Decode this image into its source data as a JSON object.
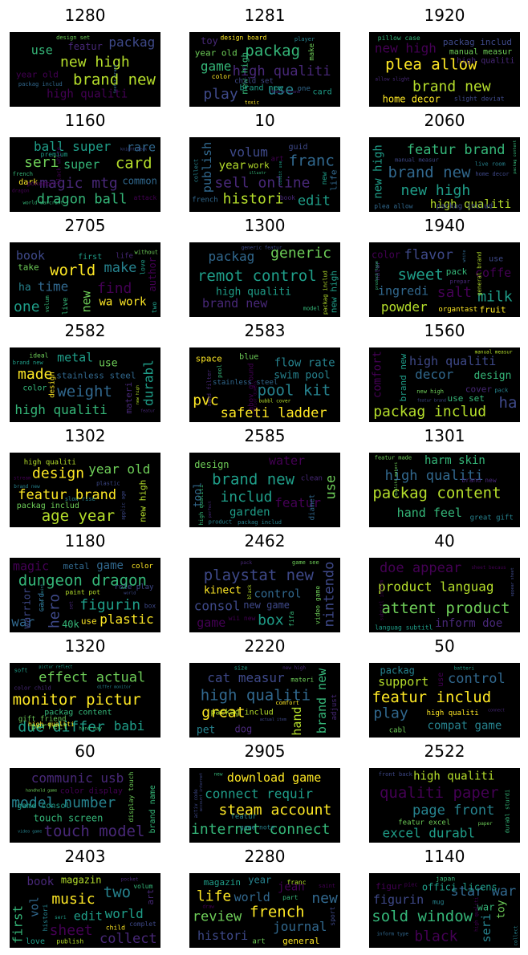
{
  "chart_data": [
    {
      "type": "wordcloud",
      "title": "1280",
      "words": [
        "brand new",
        "new high",
        "packag",
        "use",
        "high qualiti",
        "featur",
        "year old",
        "design set",
        "packag includ",
        "featur brand"
      ]
    },
    {
      "type": "wordcloud",
      "title": "1281",
      "words": [
        "packag",
        "play",
        "use",
        "high qualiti",
        "game",
        "year old",
        "new high",
        "brand new",
        "make",
        "child set",
        "toy",
        "card",
        "color",
        "one",
        "player",
        "design board",
        "featur brand",
        "toxic"
      ]
    },
    {
      "type": "wordcloud",
      "title": "1920",
      "words": [
        "plea allow",
        "brand new",
        "new high",
        "packag includ",
        "high qualiti",
        "home decor",
        "manual measur",
        "pillow case",
        "slight deviat",
        "allow slight"
      ]
    },
    {
      "type": "wordcloud",
      "title": "1160",
      "words": [
        "card",
        "magic mtg",
        "seri",
        "dragon ball",
        "ball super",
        "super",
        "rare",
        "common",
        "dark",
        "pokemon",
        "premium",
        "black white",
        "world warcraft",
        "knight deck",
        "attack",
        "french",
        "dragon"
      ]
    },
    {
      "type": "wordcloud",
      "title": "10",
      "words": [
        "franc",
        "sell online",
        "histori",
        "edit",
        "volum",
        "year",
        "publish",
        "life",
        "guid",
        "work",
        "book",
        "french",
        "art",
        "new",
        "collect",
        "condit use",
        "illustr"
      ]
    },
    {
      "type": "wordcloud",
      "title": "2060",
      "words": [
        "brand new",
        "new high",
        "featur brand",
        "high qualiti",
        "new high",
        "packag includ",
        "plea allow",
        "home decor",
        "manual measur",
        "packag content",
        "live room"
      ]
    },
    {
      "type": "wordcloud",
      "title": "2705",
      "words": [
        "world",
        "one",
        "find",
        "make",
        "time",
        "new",
        "book",
        "wa work",
        "ha",
        "take",
        "author",
        "live",
        "first",
        "life",
        "love",
        "volum",
        "two",
        "without"
      ]
    },
    {
      "type": "wordcloud",
      "title": "1300",
      "words": [
        "remot control",
        "generic",
        "packag",
        "brand new",
        "high qualiti",
        "new high",
        "generic featur",
        "packag includ",
        "model"
      ]
    },
    {
      "type": "wordcloud",
      "title": "1940",
      "words": [
        "sweet",
        "salt",
        "milk",
        "flavor",
        "powder",
        "ingredi",
        "coffe",
        "general brand",
        "fruit",
        "pack",
        "color",
        "organtast",
        "use",
        "natur",
        "white",
        "product type",
        "prepar"
      ]
    },
    {
      "type": "wordcloud",
      "title": "2582",
      "words": [
        "weight",
        "made",
        "durabl",
        "high qualiti",
        "metal",
        "stainless steel",
        "design",
        "use",
        "color",
        "materi",
        "brand new",
        "featur",
        "ideal",
        "new high"
      ]
    },
    {
      "type": "wordcloud",
      "title": "2583",
      "words": [
        "pool kit",
        "pvc",
        "safeti ladder",
        "abov ground",
        "flow rate",
        "swim pool",
        "stainless steel",
        "space",
        "sand filter",
        "blue",
        "bubbl cover",
        "interior dimens",
        "pool"
      ]
    },
    {
      "type": "wordcloud",
      "title": "1560",
      "words": [
        "ha",
        "packag includ",
        "brand new",
        "decor",
        "high qualiti",
        "comfort",
        "design",
        "use set",
        "cover",
        "new high",
        "manual measur",
        "pack",
        "featur brand"
      ]
    },
    {
      "type": "wordcloud",
      "title": "1302",
      "words": [
        "age year",
        "design",
        "featur brand",
        "year old",
        "new high",
        "packag includ",
        "high qualiti",
        "slow rise",
        "brand new",
        "plastic",
        "applic age",
        "stream"
      ]
    },
    {
      "type": "wordcloud",
      "title": "2585",
      "words": [
        "brand new",
        "includ",
        "use",
        "featur",
        "water",
        "garden",
        "tool",
        "diamet",
        "design",
        "high qualiti",
        "product",
        "clean",
        "packag includ",
        "perfect"
      ]
    },
    {
      "type": "wordcloud",
      "title": "1301",
      "words": [
        "packag content",
        "high qualiti",
        "hand feel",
        "harm skin",
        "brand new",
        "great gift",
        "qualiti materi",
        "featur made"
      ]
    },
    {
      "type": "wordcloud",
      "title": "1180",
      "words": [
        "dungeon dragon",
        "figurin",
        "hero",
        "war",
        "warrior",
        "plastic",
        "magic",
        "game",
        "metal",
        "role play",
        "color",
        "40k",
        "use",
        "card",
        "paint pot",
        "world",
        "box",
        "set",
        "acryl paint"
      ]
    },
    {
      "type": "wordcloud",
      "title": "2462",
      "words": [
        "playstat new",
        "box",
        "nintendo",
        "consol",
        "game",
        "control",
        "new game",
        "kinect",
        "wii new",
        "game see",
        "video game",
        "black",
        "fifa",
        "pack"
      ]
    },
    {
      "type": "wordcloud",
      "title": "40",
      "words": [
        "attent product",
        "doe appear",
        "product languag",
        "inform doe",
        "subtitl inform",
        "languag subtitl",
        "appear sheet",
        "sheet becaus"
      ]
    },
    {
      "type": "wordcloud",
      "title": "1320",
      "words": [
        "monitor pictur",
        "due differ",
        "effect actual",
        "babi",
        "perfect",
        "packag content",
        "gift friend",
        "high qualiti",
        "soft",
        "hand may",
        "color child",
        "differ monitor",
        "pictur reflect"
      ]
    },
    {
      "type": "wordcloud",
      "title": "2220",
      "words": [
        "high qualiti",
        "great",
        "brand new",
        "cat measur",
        "hand",
        "packag includ",
        "pet",
        "dog",
        "materi",
        "comfort",
        "new high",
        "adjust",
        "actual item",
        "size"
      ]
    },
    {
      "type": "wordcloud",
      "title": "50",
      "words": [
        "featur includ",
        "play",
        "control",
        "support",
        "compat game",
        "packag",
        "high qualiti",
        "use",
        "cabl",
        "connect",
        "batteri"
      ]
    },
    {
      "type": "wordcloud",
      "title": "60",
      "words": [
        "touch model",
        "model number",
        "communic usb",
        "touch screen",
        "game consol",
        "brand name",
        "display touch",
        "color display",
        "handheld game",
        "video game"
      ]
    },
    {
      "type": "wordcloud",
      "title": "2905",
      "words": [
        "internet connect",
        "steam account",
        "connect requir",
        "download game",
        "featur",
        "game note",
        "account internet",
        "activ code",
        "new"
      ]
    },
    {
      "type": "wordcloud",
      "title": "2522",
      "words": [
        "qualiti paper",
        "page front",
        "excel durabl",
        "high qualiti",
        "featur excel",
        "durabl sturdi",
        "front back",
        "paper"
      ]
    },
    {
      "type": "wordcloud",
      "title": "2403",
      "words": [
        "two",
        "sheet",
        "music",
        "collect",
        "first",
        "world",
        "edit",
        "vol",
        "book",
        "art",
        "magazin",
        "volum",
        "histori",
        "complet",
        "love",
        "child",
        "seri",
        "publish",
        "pocket"
      ]
    },
    {
      "type": "wordcloud",
      "title": "2280",
      "words": [
        "french",
        "life",
        "new",
        "review",
        "journal",
        "histori",
        "world",
        "jean",
        "general",
        "year",
        "franc",
        "magazin",
        "part",
        "art",
        "saint",
        "sport",
        "draw"
      ]
    },
    {
      "type": "wordcloud",
      "title": "1140",
      "words": [
        "sold window",
        "black",
        "star war",
        "offici licens",
        "figurin",
        "seri",
        "figur",
        "toy",
        "war",
        "japan",
        "collect",
        "high qualiti",
        "inform type",
        "mug",
        "piec"
      ]
    }
  ],
  "palette": [
    "#fde725",
    "#b5de2b",
    "#6ece58",
    "#35b779",
    "#1f9e89",
    "#26828e",
    "#31688e",
    "#3e4989",
    "#482878",
    "#440154"
  ]
}
